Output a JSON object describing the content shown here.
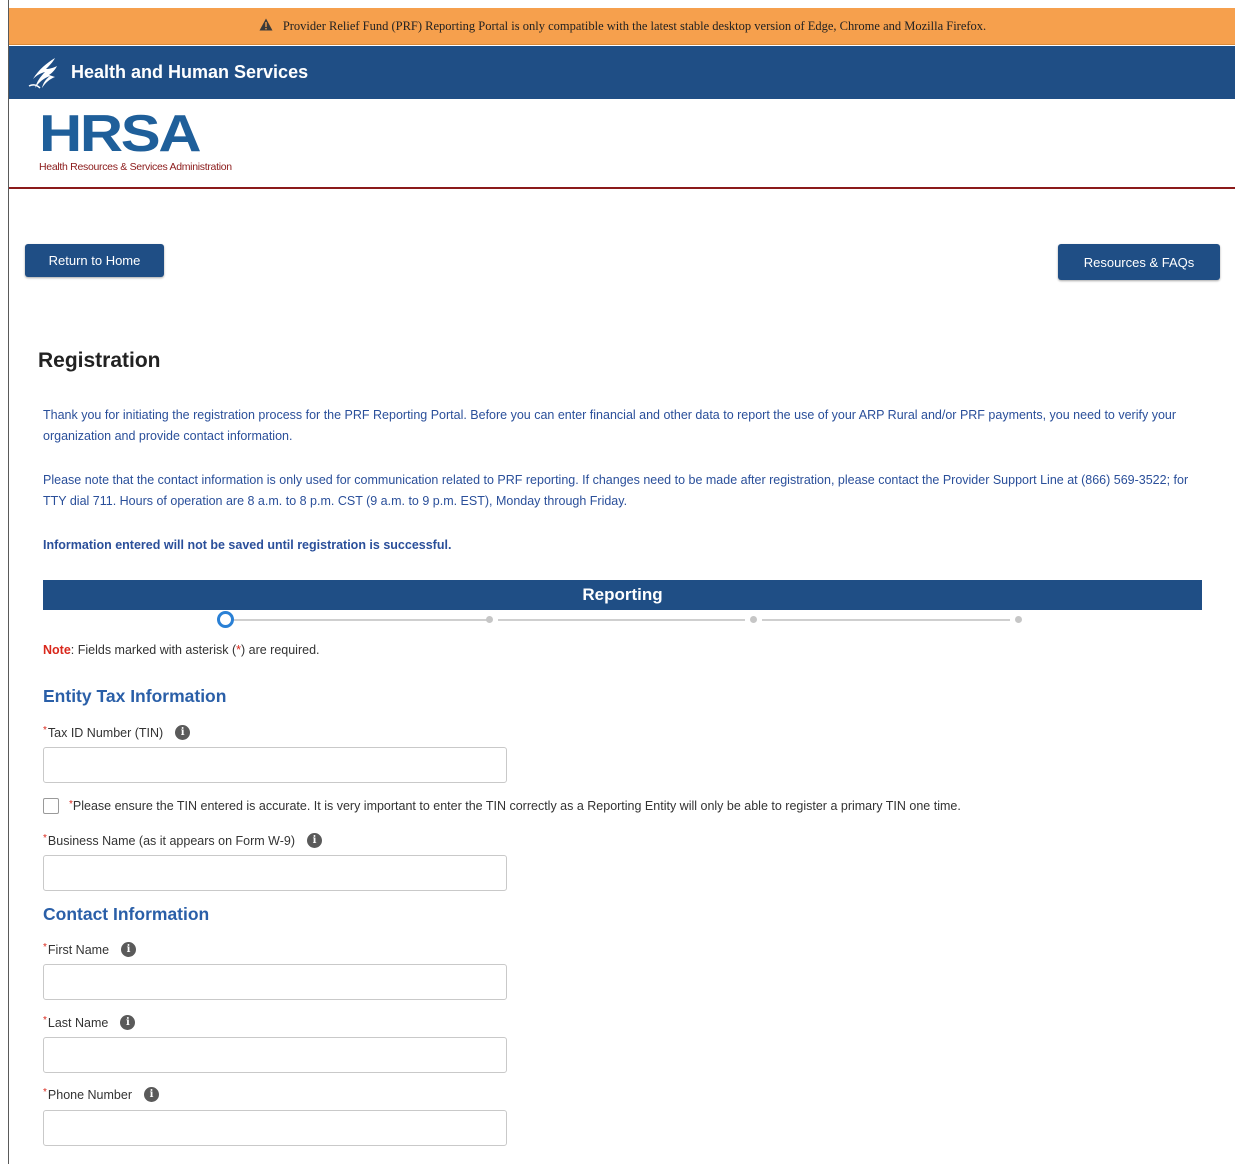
{
  "alert": {
    "text": "Provider Relief Fund (PRF) Reporting Portal is only compatible with the latest stable desktop version of Edge, Chrome and Mozilla Firefox."
  },
  "header": {
    "agency": "Health and Human Services"
  },
  "logo": {
    "letters": "HRSA",
    "subtitle": "Health Resources & Services Administration"
  },
  "nav": {
    "home_label": "Return to Home",
    "faq_label": "Resources & FAQs"
  },
  "page": {
    "title": "Registration",
    "intro": "Thank you for initiating the registration process for the PRF Reporting Portal. Before you can enter financial and other data to report the use of your ARP Rural and/or PRF payments, you need to verify your organization and provide contact information.",
    "contact_note": "Please note that the contact information is only used for communication related to PRF reporting. If changes need to be made after registration, please contact the Provider Support Line at (866) 569-3522; for TTY dial 711. Hours of operation are 8 a.m. to 8 p.m. CST (9 a.m. to 9 p.m. EST), Monday through Friday.",
    "save_warning": "Information entered will not be saved until registration is successful."
  },
  "stepper": {
    "title": "Reporting"
  },
  "note": {
    "prefix": "Note",
    "text": ": Fields marked with asterisk (",
    "ast": "*",
    "suffix": ") are required."
  },
  "sections": {
    "entity_tax": "Entity Tax Information",
    "contact": "Contact Information"
  },
  "fields": {
    "tin_label": "Tax ID Number (TIN)",
    "tin_value": "",
    "tin_confirm": "Please ensure the TIN entered is accurate. It is very important to enter the TIN correctly as a Reporting Entity will only be able to register a primary TIN one time.",
    "business_label": "Business Name (as it appears on Form W-9)",
    "business_value": "",
    "first_name_label": "First Name",
    "first_name_value": "",
    "last_name_label": "Last Name",
    "last_name_value": "",
    "phone_label": "Phone Number",
    "phone_value": ""
  },
  "icons": {
    "alert": "warning-triangle-icon",
    "agency": "hhs-eagle-icon",
    "info": "info-icon"
  },
  "colors": {
    "alert_bg": "#f6a04d",
    "primary": "#1f4e85",
    "link_text": "#2a4f9a",
    "required": "#d9281c",
    "divider": "#8b1a1a"
  }
}
